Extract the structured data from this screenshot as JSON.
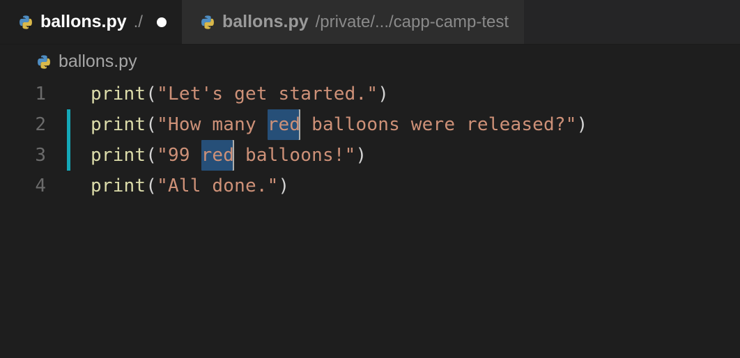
{
  "tabs": [
    {
      "filename": "ballons.py",
      "pathhint": "./",
      "dirty": true,
      "active": true
    },
    {
      "filename": "ballons.py",
      "pathhint": "/private/.../capp-camp-test",
      "dirty": false,
      "active": false
    }
  ],
  "breadcrumb": {
    "filename": "ballons.py"
  },
  "code": {
    "lines": [
      {
        "n": "1",
        "changed": false,
        "fn": "print",
        "open": "(",
        "segs": [
          [
            false,
            "\"Let's get started.\""
          ]
        ],
        "close": ")"
      },
      {
        "n": "2",
        "changed": true,
        "fn": "print",
        "open": "(",
        "segs": [
          [
            false,
            "\"How many "
          ],
          [
            true,
            "red"
          ],
          [
            false,
            " balloons were released?\""
          ]
        ],
        "close": ")"
      },
      {
        "n": "3",
        "changed": true,
        "fn": "print",
        "open": "(",
        "segs": [
          [
            false,
            "\"99 "
          ],
          [
            true,
            "red"
          ],
          [
            false,
            " balloons!\""
          ]
        ],
        "close": ")"
      },
      {
        "n": "4",
        "changed": false,
        "fn": "print",
        "open": "(",
        "segs": [
          [
            false,
            "\"All done.\""
          ]
        ],
        "close": ")"
      }
    ]
  },
  "colors": {
    "bg": "#1e1e1e",
    "tabInactive": "#2d2d2d",
    "string": "#ce9178",
    "function": "#dcdcaa",
    "selection": "#264f78",
    "changeBar": "#14a8b8"
  }
}
